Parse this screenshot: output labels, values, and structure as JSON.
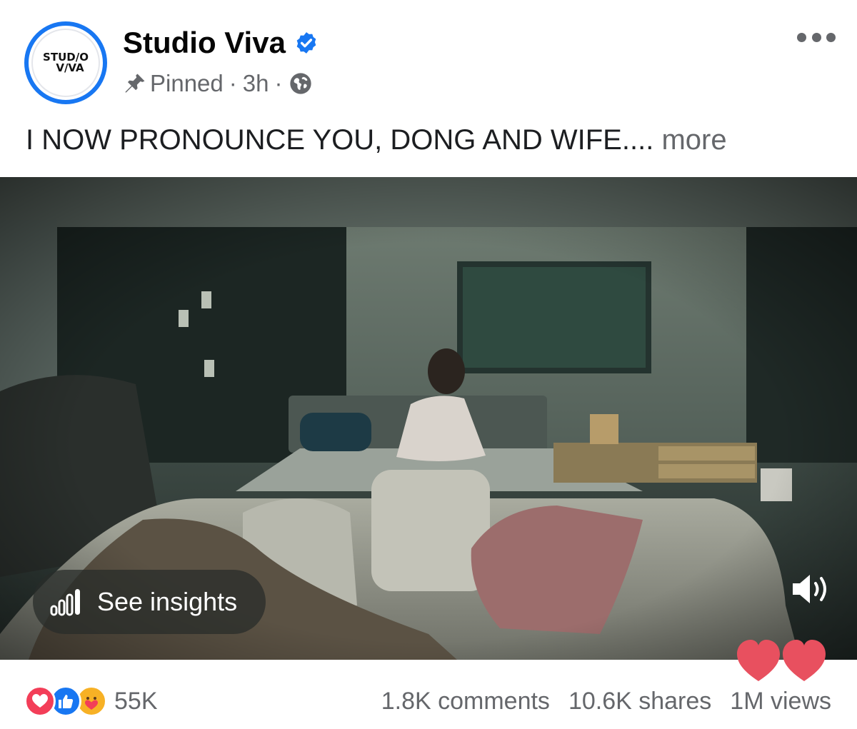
{
  "post": {
    "author": "Studio Viva",
    "avatar_lines": [
      "STUD/O",
      "V/VA"
    ],
    "pinned_label": "Pinned",
    "time": "3h",
    "caption": "I NOW PRONOUNCE YOU, DONG AND WIFE....",
    "more_label": " more"
  },
  "video": {
    "insights_label": "See insights",
    "sound_icon": "speaker-on-icon"
  },
  "footer": {
    "reaction_icons": [
      "love-reaction-icon",
      "like-reaction-icon",
      "care-reaction-icon"
    ],
    "reaction_count": "55K",
    "comments": "1.8K comments",
    "shares": "10.6K shares",
    "views": "1M views"
  },
  "colors": {
    "accent": "#1877f2",
    "secondary_text": "#65676b",
    "love": "#f33e58",
    "floating_hearts": "#e8505f"
  }
}
